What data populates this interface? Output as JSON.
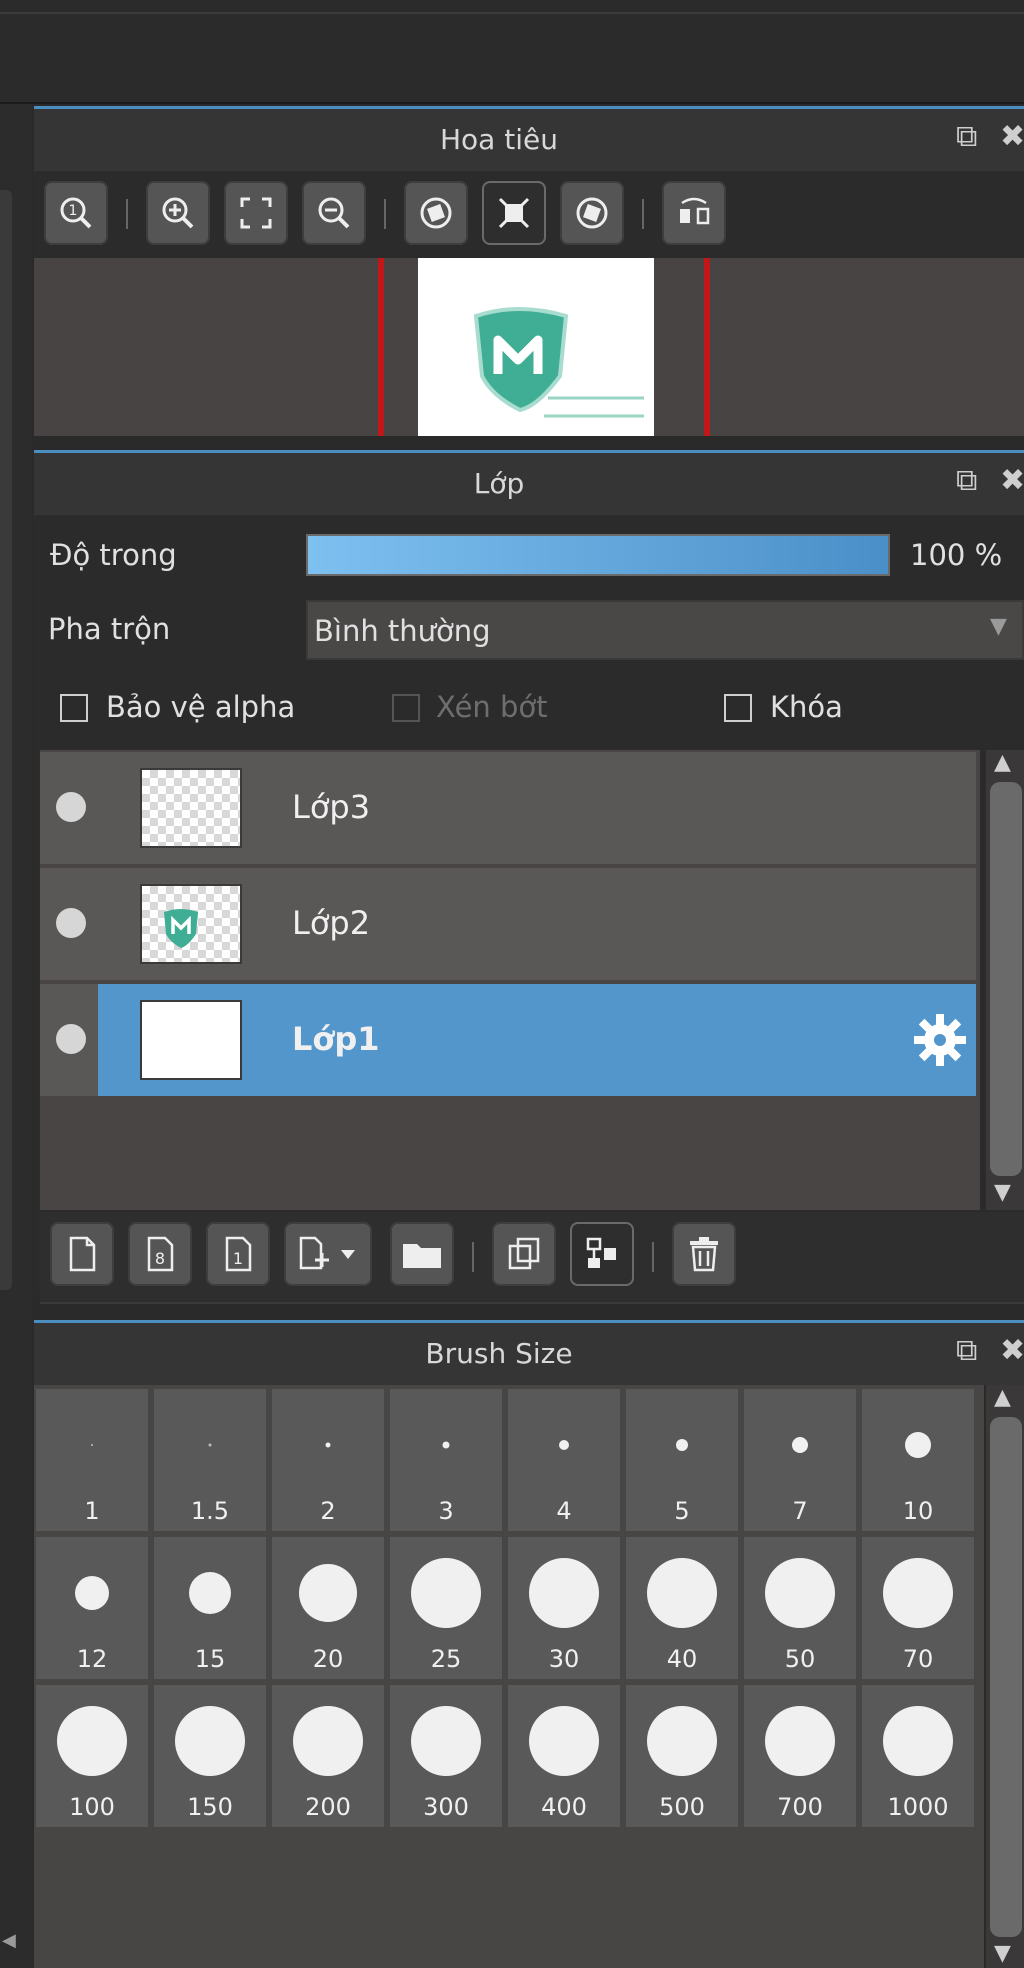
{
  "navigator": {
    "title": "Hoa tiêu"
  },
  "layers": {
    "title": "Lớp",
    "opacity_label": "Độ trong",
    "opacity_value": "100 %",
    "opacity_percent": 100,
    "blend_label": "Pha trộn",
    "blend_value": "Bình thường",
    "protect_alpha_label": "Bảo vệ alpha",
    "clipping_label": "Xén bớt",
    "lock_label": "Khóa",
    "items": [
      {
        "name": "Lớp3",
        "selected": false
      },
      {
        "name": "Lớp2",
        "selected": false
      },
      {
        "name": "Lớp1",
        "selected": true
      }
    ]
  },
  "brush_size": {
    "title": "Brush Size",
    "sizes": [
      "1",
      "1.5",
      "2",
      "3",
      "4",
      "5",
      "7",
      "10",
      "12",
      "15",
      "20",
      "25",
      "30",
      "40",
      "50",
      "70",
      "100",
      "150",
      "200",
      "300",
      "400",
      "500",
      "700",
      "1000"
    ]
  },
  "colors": {
    "accent": "#4a8fc0",
    "selected_layer": "#5296cc",
    "navigator_frame": "#c01818",
    "logo_teal": "#3fae94"
  }
}
